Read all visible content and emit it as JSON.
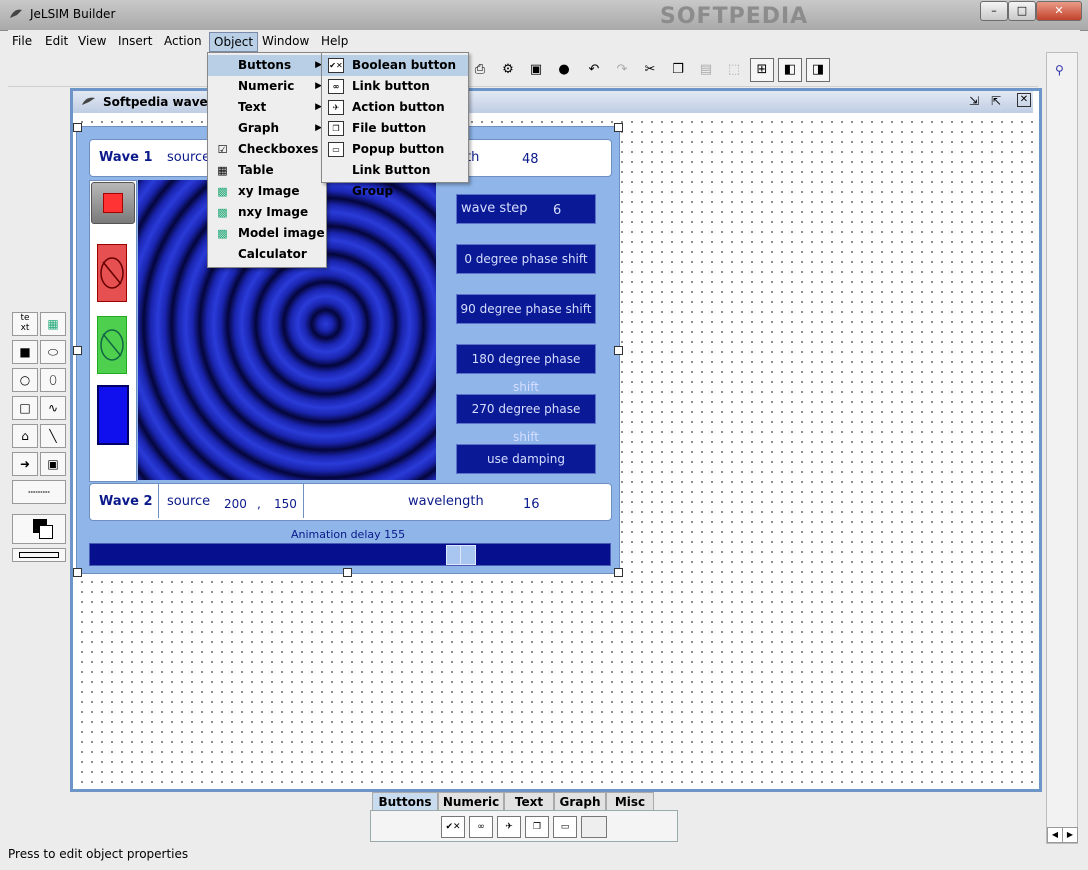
{
  "window": {
    "title": "JeLSIM Builder",
    "watermark": "SOFTPEDIA"
  },
  "menubar": [
    "File",
    "Edit",
    "View",
    "Insert",
    "Action",
    "Object",
    "Window",
    "Help"
  ],
  "object_menu": [
    {
      "label": "Buttons",
      "icon": "",
      "submenu": true
    },
    {
      "label": "Numeric",
      "icon": "",
      "submenu": true
    },
    {
      "label": "Text",
      "icon": "",
      "submenu": true
    },
    {
      "label": "Graph",
      "icon": "",
      "submenu": true
    },
    {
      "label": "Checkboxes",
      "icon": "checkbox-icon",
      "submenu": false
    },
    {
      "label": "Table",
      "icon": "table-icon",
      "submenu": false
    },
    {
      "label": "xy Image",
      "icon": "image-icon",
      "submenu": false
    },
    {
      "label": "nxy Image",
      "icon": "image-icon",
      "submenu": false
    },
    {
      "label": "Model image",
      "icon": "image-icon",
      "submenu": false
    },
    {
      "label": "Calculator",
      "icon": "",
      "submenu": false
    }
  ],
  "buttons_submenu": [
    {
      "label": "Boolean button",
      "icon": "boolean-button-icon"
    },
    {
      "label": "Link button",
      "icon": "link-button-icon"
    },
    {
      "label": "Action button",
      "icon": "action-button-icon"
    },
    {
      "label": "File button",
      "icon": "file-button-icon"
    },
    {
      "label": "Popup button",
      "icon": "popup-button-icon"
    },
    {
      "label": "Link Button Group",
      "icon": ""
    }
  ],
  "frame": {
    "title": "Softpedia waves.js"
  },
  "sim": {
    "wave1": {
      "label": "Wave 1",
      "source": "source",
      "wavelength_frag": "th",
      "wavelength_value": "48"
    },
    "wave2": {
      "label": "Wave 2",
      "source": "source",
      "x": "200",
      "sep": ",",
      "y": "150",
      "wavelength": "wavelength",
      "wavelength_value": "16"
    },
    "wavestep": {
      "label": "wave step",
      "value": "6"
    },
    "buttons": [
      "0 degree phase shift",
      "90 degree phase shift",
      "180 degree phase shift",
      "270 degree phase shift",
      "use damping"
    ],
    "anim": {
      "label": "Animation delay",
      "value": "155",
      "slider_fraction": 0.75
    }
  },
  "palette": {
    "tabs": [
      "Buttons",
      "Numeric",
      "Text",
      "Graph",
      "Misc"
    ],
    "active": "Buttons"
  },
  "status": "Press to edit object properties"
}
